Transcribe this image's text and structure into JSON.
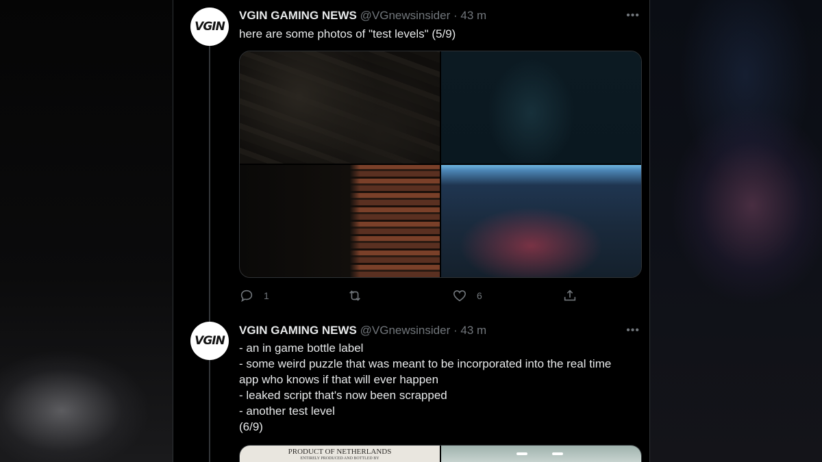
{
  "tweets": [
    {
      "avatar_text": "VGIN",
      "name": "VGIN GAMING NEWS",
      "handle": "@VGnewsinsider",
      "separator": "·",
      "time": "43 m",
      "more": "•••",
      "text_lines": [
        "here are some photos of \"test levels\" (5/9)"
      ],
      "photos": [
        {
          "name": "dark-stone-wall-photo"
        },
        {
          "name": "dark-blue-hand-photo"
        },
        {
          "name": "brick-column-photo"
        },
        {
          "name": "red-lit-rubble-level-photo"
        }
      ],
      "actions": {
        "reply_count": "1",
        "retweet_count": "",
        "like_count": "6"
      }
    },
    {
      "avatar_text": "VGIN",
      "name": "VGIN GAMING NEWS",
      "handle": "@VGnewsinsider",
      "separator": "·",
      "time": "43 m",
      "more": "•••",
      "text_lines": [
        "- an in game bottle label",
        "- some weird puzzle that was meant to be incorporated into the real time",
        "app who knows if that will ever happen",
        "- leaked script that's now been scrapped",
        "- another test level",
        "(6/9)"
      ],
      "media_preview": {
        "label_title": "PRODUCT OF NETHERLANDS",
        "label_sub": "ENTIRELY PRODUCED AND BOTTLED BY"
      }
    }
  ],
  "colors": {
    "background": "#000000",
    "text": "#e7e9ea",
    "secondary": "#71767b",
    "border": "#2f3336"
  },
  "icons": {
    "reply": "reply-icon",
    "retweet": "retweet-icon",
    "like": "heart-icon",
    "share": "share-icon",
    "more": "more-icon"
  }
}
